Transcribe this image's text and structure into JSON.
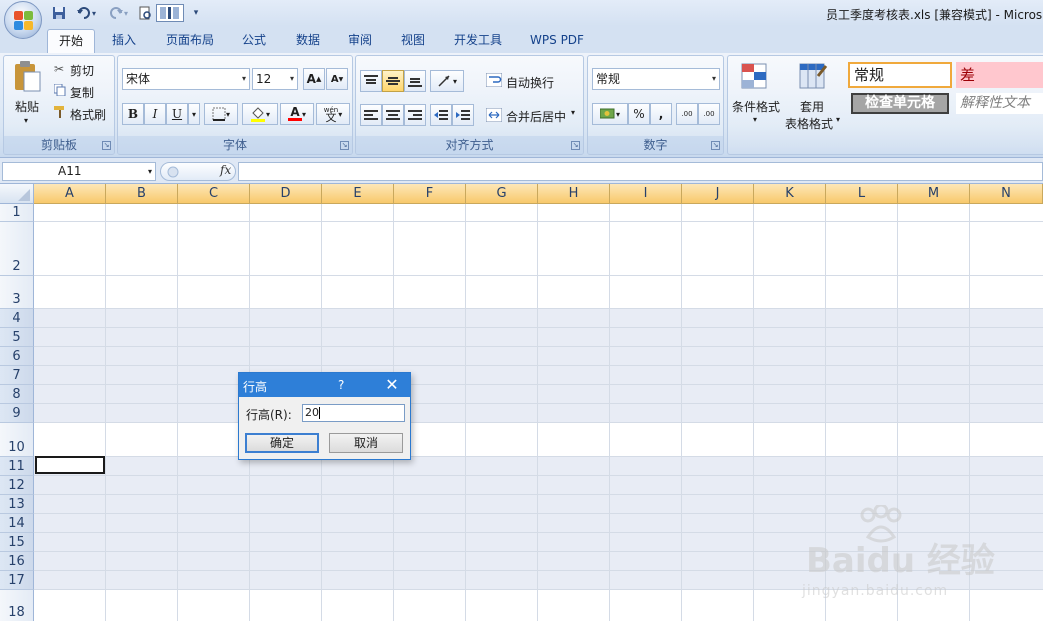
{
  "window": {
    "title": "员工季度考核表.xls  [兼容模式] - Micros"
  },
  "menu_tabs": [
    "开始",
    "插入",
    "页面布局",
    "公式",
    "数据",
    "审阅",
    "视图",
    "开发工具",
    "WPS PDF"
  ],
  "ribbon": {
    "clipboard": {
      "paste": "粘贴",
      "cut": "剪切",
      "copy": "复制",
      "format_painter": "格式刷",
      "label": "剪贴板"
    },
    "font": {
      "name": "宋体",
      "size": "12",
      "label": "字体",
      "bold": "B",
      "italic": "I",
      "underline": "U",
      "grow": "A",
      "shrink": "A",
      "wen": "wén",
      "wen2": "文",
      "font_color_a": "A"
    },
    "alignment": {
      "wrap": "自动换行",
      "merge": "合并后居中",
      "label": "对齐方式"
    },
    "number": {
      "format": "常规",
      "percent": "%",
      "comma": ",",
      "inc": ".00",
      "dec": ".00",
      "label": "数字"
    },
    "styles": {
      "conditional": "条件格式",
      "table_line1": "套用",
      "table_line2": "表格格式",
      "normal": "常规",
      "bad": "差",
      "check_cell": "检查单元格",
      "explanatory": "解释性文本"
    }
  },
  "formula_bar": {
    "name_box": "A11",
    "fx": "fx",
    "content": ""
  },
  "columns": [
    "A",
    "B",
    "C",
    "D",
    "E",
    "F",
    "G",
    "H",
    "I",
    "J",
    "K",
    "L",
    "M",
    "N"
  ],
  "rows": [
    "1",
    "2",
    "3",
    "4",
    "5",
    "6",
    "7",
    "8",
    "9",
    "10",
    "11",
    "12",
    "13",
    "14",
    "15",
    "16",
    "17",
    "18"
  ],
  "dialog": {
    "title": "行高",
    "help": "?",
    "close": "✕",
    "label": "行高(R):",
    "value": "20",
    "ok": "确定",
    "cancel": "取消"
  },
  "watermark": {
    "text": "Baidu 经验",
    "url": "jingyan.baidu.com"
  }
}
